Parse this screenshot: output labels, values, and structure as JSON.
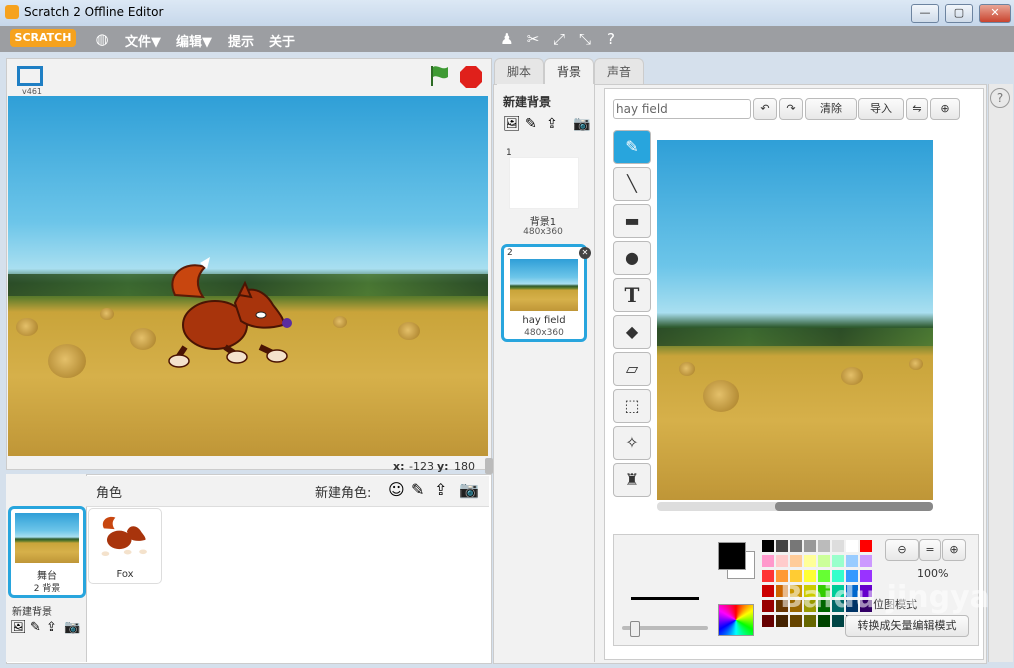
{
  "window": {
    "title": "Scratch 2 Offline Editor",
    "min": "—",
    "max": "▢",
    "close": "✕"
  },
  "menubar": {
    "logo": "SCRATCH",
    "file": "文件▼",
    "edit": "编辑▼",
    "tips": "提示",
    "about": "关于"
  },
  "stage": {
    "version": "v461",
    "x_label": "x:",
    "x_value": "-123",
    "y_label": "y:",
    "y_value": "180"
  },
  "sprites": {
    "header": "角色",
    "new_sprite_label": "新建角色:",
    "stage_label": "舞台",
    "stage_count": "2 背景",
    "new_backdrop_label": "新建背景",
    "items": [
      {
        "name": "Fox"
      }
    ]
  },
  "tabs": [
    {
      "label": "脚本"
    },
    {
      "label": "背景"
    },
    {
      "label": "声音"
    }
  ],
  "backdrops": {
    "new_label": "新建背景",
    "items": [
      {
        "index": "1",
        "name": "背景1",
        "size": "480x360"
      },
      {
        "index": "2",
        "name": "hay field",
        "size": "480x360"
      }
    ]
  },
  "editor": {
    "name_value": "hay field",
    "clear": "清除",
    "import": "导入",
    "zoom": "100%",
    "convert_label": "转换成矢量编辑模式",
    "mode_label": "位图模式"
  },
  "watermark": "Baidu jingyan",
  "colors": {
    "accent": "#28a5dd",
    "menubar": "#9c9ea2",
    "logo": "#f6a21e",
    "stop": "#e0201b",
    "flag": "#3f9a34"
  }
}
